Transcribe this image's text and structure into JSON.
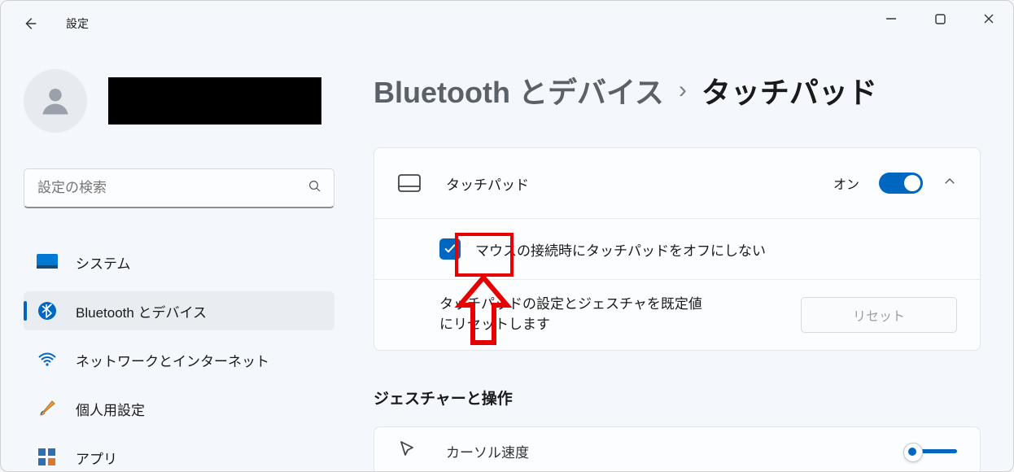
{
  "window": {
    "app_title": "設定"
  },
  "search": {
    "placeholder": "設定の検索"
  },
  "sidebar": {
    "items": [
      {
        "label": "システム"
      },
      {
        "label": "Bluetooth とデバイス"
      },
      {
        "label": "ネットワークとインターネット"
      },
      {
        "label": "個人用設定"
      },
      {
        "label": "アプリ"
      }
    ]
  },
  "breadcrumb": {
    "parent": "Bluetooth とデバイス",
    "separator": "›",
    "current": "タッチパッド"
  },
  "touchpad": {
    "title": "タッチパッド",
    "state_label": "オン",
    "state_on": true,
    "keep_on_with_mouse_label": "マウスの接続時にタッチパッドをオフにしない",
    "keep_on_with_mouse_checked": true,
    "reset_desc": "タッチパッドの設定とジェスチャを既定値にリセットします",
    "reset_button": "リセット"
  },
  "gestures": {
    "section_title": "ジェスチャーと操作",
    "cursor_speed_label": "カーソル速度"
  },
  "colors": {
    "accent": "#0067c0",
    "annotation": "#e60000"
  }
}
